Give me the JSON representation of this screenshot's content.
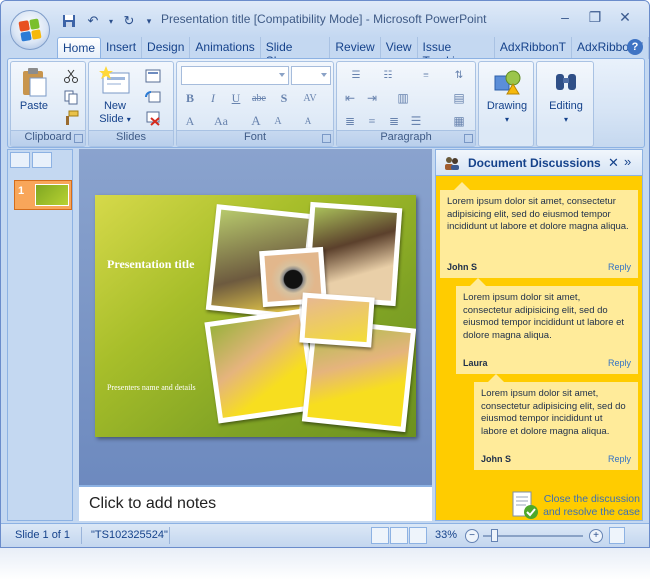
{
  "titlebar": {
    "title": "Presentation title [Compatibility Mode] - Microsoft PowerPoint",
    "qat_icons": [
      "save-icon",
      "undo-icon",
      "redo-icon",
      "customize-qat-icon"
    ]
  },
  "tabs": [
    "Home",
    "Insert",
    "Design",
    "Animations",
    "Slide Show",
    "Review",
    "View",
    "Issue Trackir",
    "AdxRibbonT",
    "AdxRibbonT"
  ],
  "ribbon": {
    "groups": {
      "clipboard": "Clipboard",
      "slides": "Slides",
      "font": "Font",
      "paragraph": "Paragraph"
    },
    "paste_label": "Paste",
    "new_slide_label": "New Slide",
    "new_slide_label_1": "New",
    "new_slide_label_2": "Slide",
    "drawing_label": "Drawing",
    "editing_label": "Editing"
  },
  "slide": {
    "title": "Presentation title",
    "subtitle": "Presenters name and details"
  },
  "thumbnails": [
    {
      "number": "1"
    }
  ],
  "notes_placeholder": "Click to add notes",
  "discussion": {
    "title": "Document Discussions",
    "comments": [
      {
        "text": "Lorem ipsum dolor sit amet, consectetur adipisicing elit, sed do eiusmod tempor incididunt ut labore et dolore magna aliqua.",
        "author": "John S",
        "reply": "Reply"
      },
      {
        "text": "Lorem ipsum dolor sit amet, consectetur adipisicing elit, sed do eiusmod tempor incididunt ut labore et dolore magna aliqua.",
        "author": "Laura",
        "reply": "Reply"
      },
      {
        "text": "Lorem ipsum dolor sit amet, consectetur adipisicing elit, sed do eiusmod tempor incididunt ut labore et dolore magna aliqua.",
        "author": "John S",
        "reply": "Reply"
      }
    ],
    "close_link": "Close the discussion and resolve the case"
  },
  "status": {
    "slide_info": "Slide 1 of 1",
    "theme": "\"TS102325524\"",
    "zoom": "33%"
  },
  "colors": {
    "ribbon_blue": "#c4d8f1",
    "discussion_bg": "#ffcc00",
    "comment_bg": "#ffeb9a",
    "slide_green": "#7fa224"
  }
}
